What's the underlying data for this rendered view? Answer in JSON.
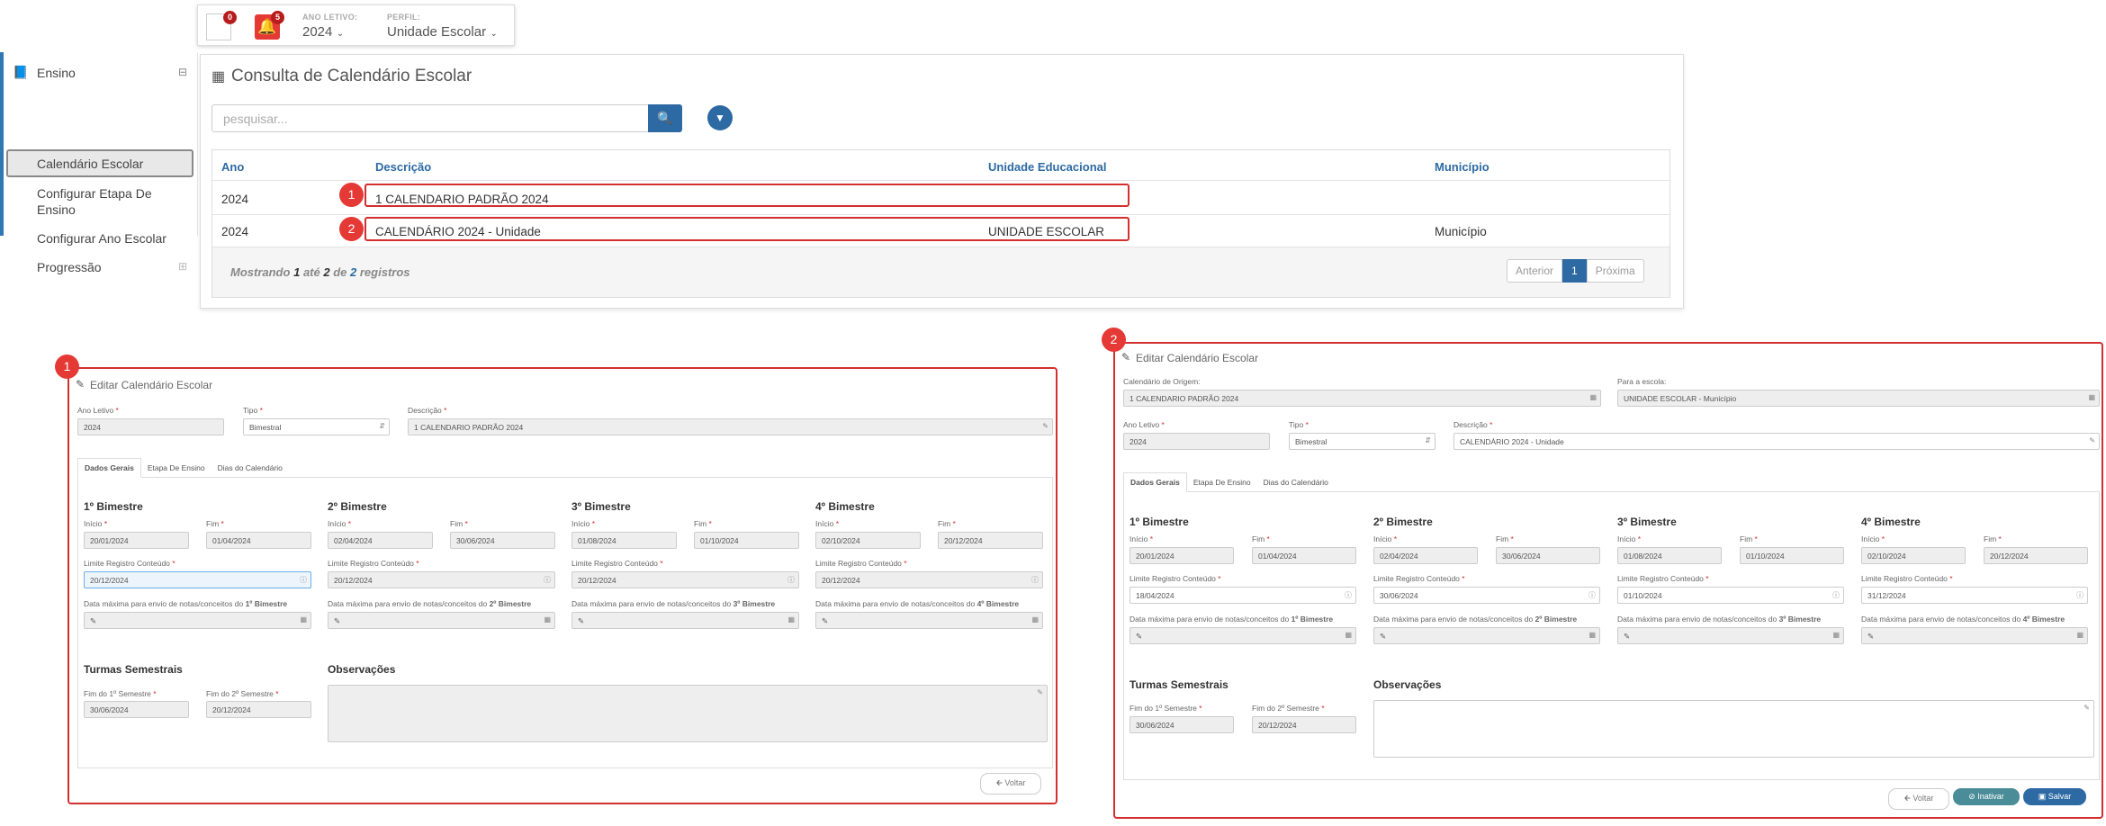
{
  "topbar": {
    "messages_count": "0",
    "alerts_count": "5",
    "ano_label": "ANO LETIVO:",
    "ano_value": "2024",
    "perfil_label": "PERFIL:",
    "perfil_value": "Unidade Escolar"
  },
  "sidebar": {
    "section": "Ensino",
    "items": [
      "Calendário Escolar",
      "Configurar Etapa De Ensino",
      "Configurar Ano Escolar",
      "Progressão"
    ]
  },
  "consulta": {
    "title": "Consulta de Calendário Escolar",
    "search_placeholder": "pesquisar...",
    "headers": [
      "Ano",
      "Descrição",
      "Unidade Educacional",
      "Município"
    ],
    "rows": [
      {
        "ano": "2024",
        "descricao": "1 CALENDARIO PADRÃO 2024",
        "unidade": "",
        "municipio": ""
      },
      {
        "ano": "2024",
        "descricao": "CALENDÁRIO 2024 - Unidade",
        "unidade": "UNIDADE ESCOLAR",
        "municipio": "Município"
      }
    ],
    "footer_info": {
      "prefix": "Mostrando",
      "from": "1",
      "ate": "até",
      "to": "2",
      "de": "de",
      "total": "2",
      "suffix": "registros"
    },
    "pagination": {
      "prev": "Anterior",
      "page": "1",
      "next": "Próxima"
    },
    "callouts": [
      "1",
      "2"
    ]
  },
  "form1": {
    "callout": "1",
    "title": "Editar Calendário Escolar",
    "ano_label": "Ano Letivo",
    "ano_value": "2024",
    "tipo_label": "Tipo",
    "tipo_value": "Bimestral",
    "desc_label": "Descrição",
    "desc_value": "1 CALENDARIO PADRÃO 2024",
    "tabs": [
      "Dados Gerais",
      "Etapa De Ensino",
      "Dias do Calendário"
    ],
    "bimestres": [
      {
        "title": "1º Bimestre",
        "inicio": "20/01/2024",
        "fim": "01/04/2024",
        "limite": "20/12/2024",
        "data_label": "Data máxima para envio de notas/conceitos do",
        "data_bold": "1º Bimestre"
      },
      {
        "title": "2º Bimestre",
        "inicio": "02/04/2024",
        "fim": "30/06/2024",
        "limite": "20/12/2024",
        "data_label": "Data máxima para envio de notas/conceitos do",
        "data_bold": "2º Bimestre"
      },
      {
        "title": "3º Bimestre",
        "inicio": "01/08/2024",
        "fim": "01/10/2024",
        "limite": "20/12/2024",
        "data_label": "Data máxima para envio de notas/conceitos do",
        "data_bold": "3º Bimestre"
      },
      {
        "title": "4º Bimestre",
        "inicio": "02/10/2024",
        "fim": "20/12/2024",
        "limite": "20/12/2024",
        "data_label": "Data máxima para envio de notas/conceitos do",
        "data_bold": "4º Bimestre"
      }
    ],
    "inicio_label": "Início",
    "fim_label": "Fim",
    "limite_label": "Limite Registro Conteúdo",
    "turmas_title": "Turmas Semestrais",
    "fim1_label": "Fim do 1º Semestre",
    "fim1_value": "30/06/2024",
    "fim2_label": "Fim do 2º Semestre",
    "fim2_value": "20/12/2024",
    "obs_title": "Observações",
    "voltar": "Voltar"
  },
  "form2": {
    "callout": "2",
    "title": "Editar Calendário Escolar",
    "origem_label": "Calendário de Origem:",
    "origem_value": "1 CALENDARIO PADRÃO 2024",
    "escola_label": "Para a escola:",
    "escola_value": "UNIDADE ESCOLAR - Município",
    "ano_label": "Ano Letivo",
    "ano_value": "2024",
    "tipo_label": "Tipo",
    "tipo_value": "Bimestral",
    "desc_label": "Descrição",
    "desc_value": "CALENDÁRIO 2024 - Unidade",
    "tabs": [
      "Dados Gerais",
      "Etapa De Ensino",
      "Dias do Calendário"
    ],
    "bimestres": [
      {
        "title": "1º Bimestre",
        "inicio": "20/01/2024",
        "fim": "01/04/2024",
        "limite": "18/04/2024",
        "data_label": "Data máxima para envio de notas/conceitos do",
        "data_bold": "1º Bimestre"
      },
      {
        "title": "2º Bimestre",
        "inicio": "02/04/2024",
        "fim": "30/06/2024",
        "limite": "30/06/2024",
        "data_label": "Data máxima para envio de notas/conceitos do",
        "data_bold": "2º Bimestre"
      },
      {
        "title": "3º Bimestre",
        "inicio": "01/08/2024",
        "fim": "01/10/2024",
        "limite": "01/10/2024",
        "data_label": "Data máxima para envio de notas/conceitos do",
        "data_bold": "3º Bimestre"
      },
      {
        "title": "4º Bimestre",
        "inicio": "02/10/2024",
        "fim": "20/12/2024",
        "limite": "31/12/2024",
        "data_label": "Data máxima para envio de notas/conceitos do",
        "data_bold": "4º Bimestre"
      }
    ],
    "inicio_label": "Início",
    "fim_label": "Fim",
    "limite_label": "Limite Registro Conteúdo",
    "turmas_title": "Turmas Semestrais",
    "fim1_label": "Fim do 1º Semestre",
    "fim1_value": "30/06/2024",
    "fim2_label": "Fim do 2º Semestre",
    "fim2_value": "20/12/2024",
    "obs_title": "Observações",
    "voltar": "Voltar",
    "inativar": "Inativar",
    "salvar": "Salvar"
  }
}
